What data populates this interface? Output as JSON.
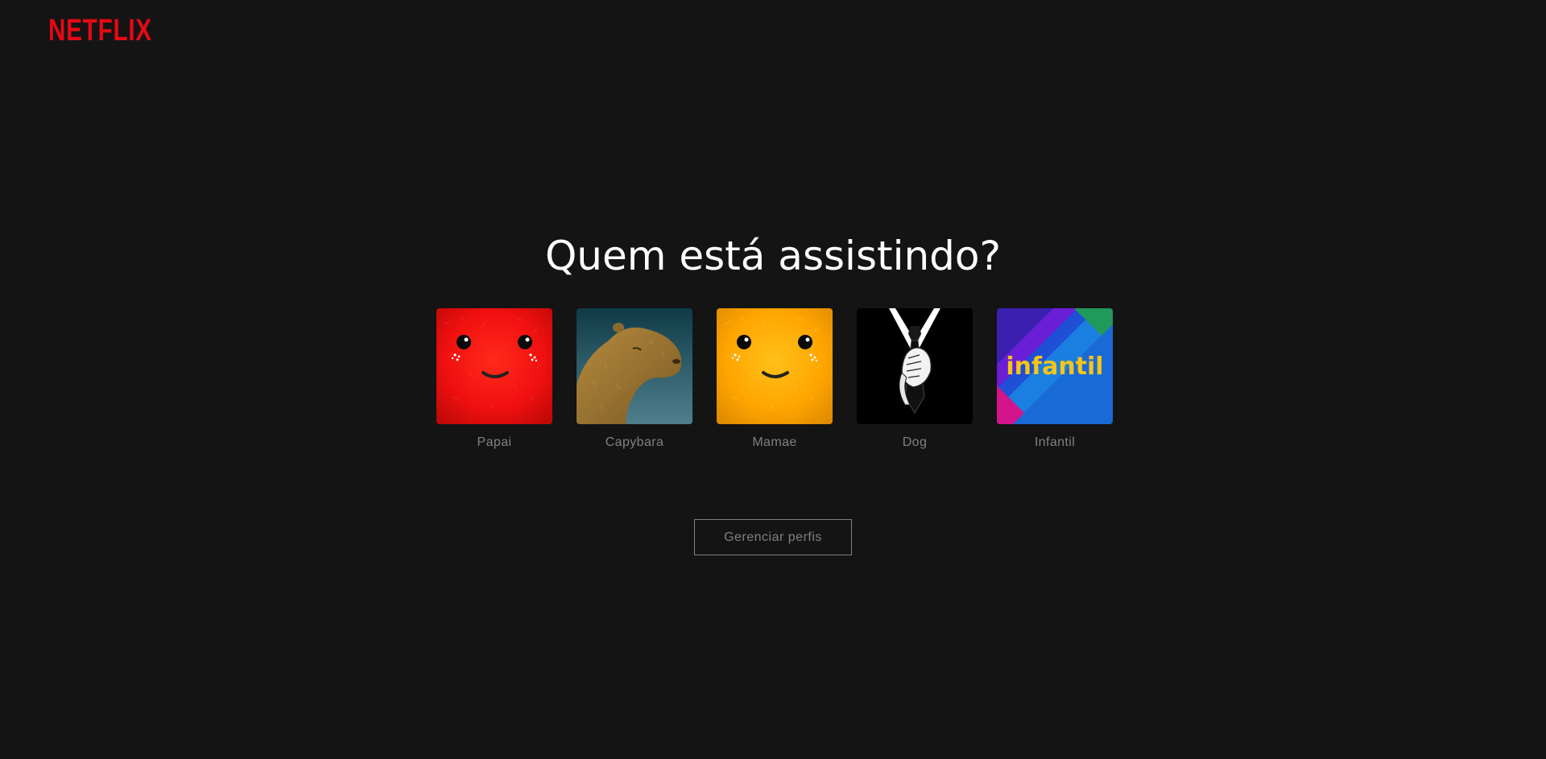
{
  "brand": {
    "logo_text": "NETFLIX",
    "logo_color": "#e50914"
  },
  "heading": "Quem está assistindo?",
  "profiles": [
    {
      "name": "Papai",
      "avatar": "red-fuzzy-smile-avatar"
    },
    {
      "name": "Capybara",
      "avatar": "capybara-avatar"
    },
    {
      "name": "Mamae",
      "avatar": "yellow-fuzzy-smile-avatar"
    },
    {
      "name": "Dog",
      "avatar": "suit-tie-avatar"
    },
    {
      "name": "Infantil",
      "avatar": "kids-avatar",
      "avatar_text": "infantil"
    }
  ],
  "manage_button": "Gerenciar perfis",
  "colors": {
    "background": "#141414",
    "heading": "#ffffff",
    "muted": "#808080"
  }
}
